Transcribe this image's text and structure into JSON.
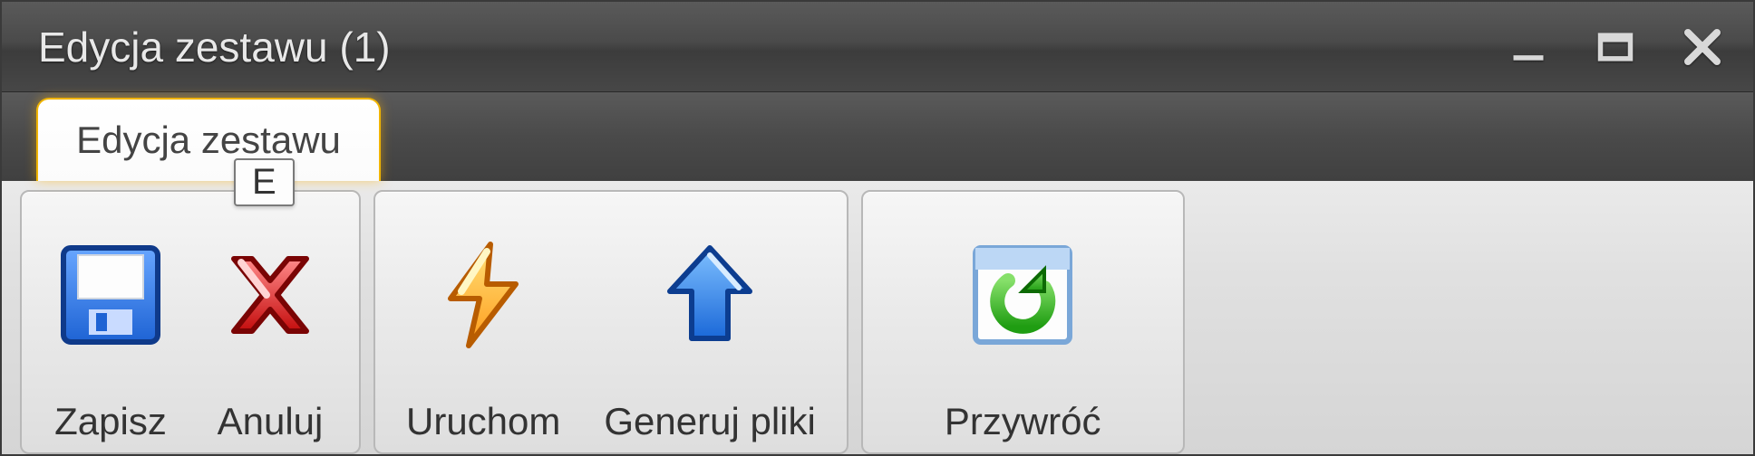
{
  "window": {
    "title": "Edycja zestawu (1)"
  },
  "tabs": [
    {
      "label": "Edycja zestawu",
      "keytip": "E"
    }
  ],
  "ribbon": {
    "groups": [
      {
        "buttons": [
          {
            "id": "save",
            "label": "Zapisz",
            "icon": "save-icon"
          },
          {
            "id": "cancel",
            "label": "Anuluj",
            "icon": "x-icon"
          }
        ]
      },
      {
        "buttons": [
          {
            "id": "run",
            "label": "Uruchom",
            "icon": "bolt-icon"
          },
          {
            "id": "generate",
            "label": "Generuj pliki",
            "icon": "upload-icon"
          }
        ]
      },
      {
        "buttons": [
          {
            "id": "restore",
            "label": "Przywróć",
            "icon": "refresh-icon"
          }
        ]
      }
    ]
  }
}
